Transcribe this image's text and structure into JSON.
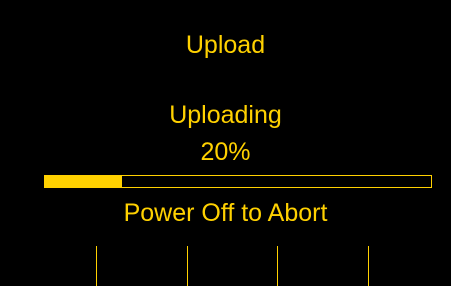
{
  "screen": {
    "title": "Upload",
    "status_text": "Uploading",
    "percent_text": "20%",
    "abort_hint": "Power Off to Abort"
  },
  "progress": {
    "value": 0.2
  },
  "softkeys": {
    "count": 5
  },
  "colors": {
    "background": "#000000",
    "accent": "#FFD100"
  }
}
